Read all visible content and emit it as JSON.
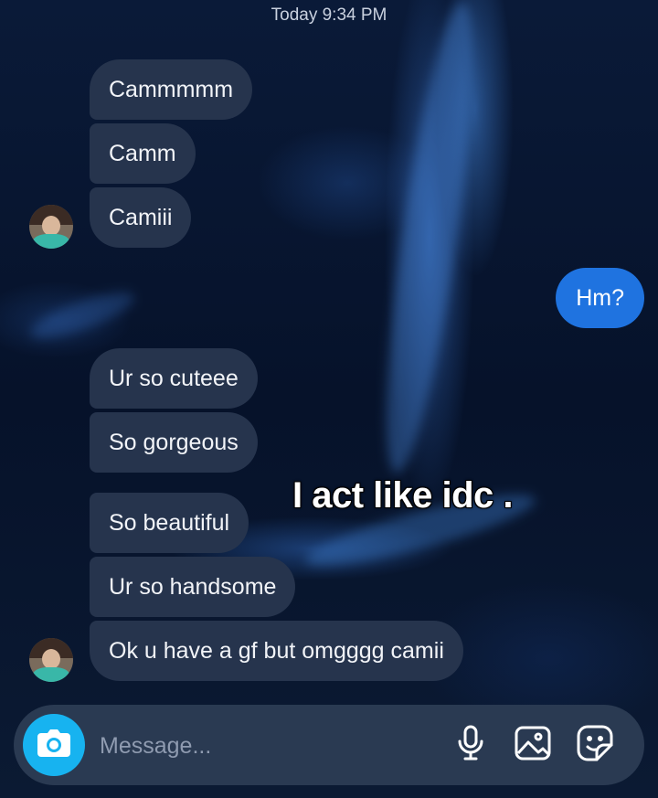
{
  "header": {
    "timestamp": "Today 9:34 PM"
  },
  "messages": {
    "received_group_1": [
      "Cammmmm",
      "Camm",
      "Camiii"
    ],
    "sent": "Hm?",
    "received_group_2": [
      "Ur so cuteee",
      "So gorgeous",
      "So beautiful",
      "Ur so handsome",
      "Ok u have a gf but omgggg camii"
    ]
  },
  "overlay": {
    "caption": "I act like idc ."
  },
  "composer": {
    "placeholder": "Message...",
    "icons": [
      "camera-icon",
      "microphone-icon",
      "gallery-icon",
      "sticker-icon"
    ]
  },
  "colors": {
    "received_bubble": "#26344d",
    "sent_bubble": "#1f73e0",
    "camera_button": "#17b3f0",
    "composer": "#2a3a52"
  }
}
